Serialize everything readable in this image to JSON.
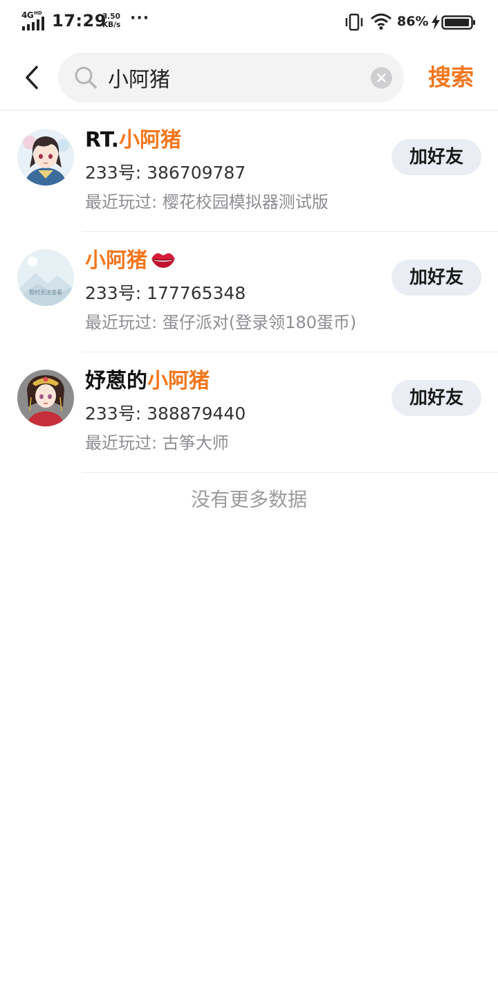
{
  "status_bar": {
    "network": "4G",
    "network_badge": "HD",
    "time": "17:29",
    "speed_value": "3.50",
    "speed_unit": "KB/s",
    "more": "···",
    "battery_percent": "86%"
  },
  "search": {
    "query": "小阿猪",
    "submit_label": "搜索",
    "accent_color": "#f4761c"
  },
  "results": [
    {
      "name_prefix": "RT.",
      "name_highlight": "小阿猪",
      "uid": "233号: 386709787",
      "recent": "最近玩过: 樱花校园模拟器测试版",
      "button_label": "加好友",
      "avatar_icon": "anime-avatar-icon"
    },
    {
      "name_prefix": "",
      "name_highlight": "小阿猪",
      "emoji_icon": "lips-icon",
      "uid": "233号: 177765348",
      "recent": "最近玩过: 蛋仔派对(登录领180蛋币)",
      "button_label": "加好友",
      "avatar_icon": "placeholder-image-icon",
      "avatar_caption": "暂时无法查看"
    },
    {
      "name_prefix": "妤蒽的",
      "name_highlight": "小阿猪",
      "uid": "233号: 388879440",
      "recent": "最近玩过: 古筝大师",
      "button_label": "加好友",
      "avatar_icon": "anime-avatar-icon"
    }
  ],
  "footer": {
    "no_more": "没有更多数据"
  }
}
